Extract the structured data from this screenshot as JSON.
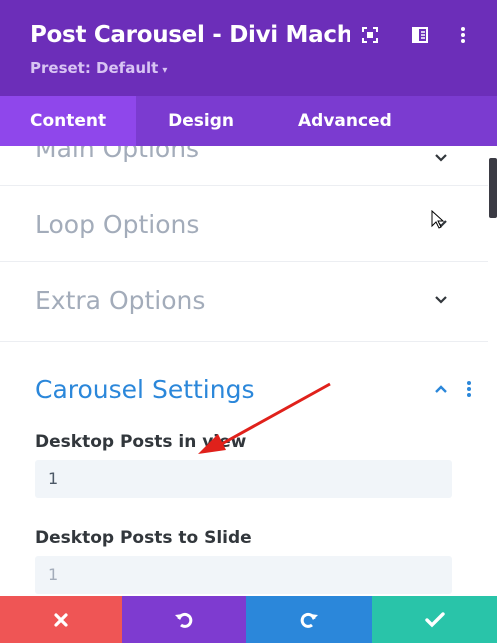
{
  "header": {
    "title": "Post Carousel - Divi Machin...",
    "preset": "Preset: Default",
    "icons": [
      "focus-icon",
      "sidebar-icon",
      "more-vertical-icon"
    ]
  },
  "tabs": [
    {
      "label": "Content",
      "active": true
    },
    {
      "label": "Design",
      "active": false
    },
    {
      "label": "Advanced",
      "active": false
    }
  ],
  "sections": [
    {
      "title": "Main Options",
      "state": "collapsed"
    },
    {
      "title": "Loop Options",
      "state": "collapsed"
    },
    {
      "title": "Extra Options",
      "state": "collapsed"
    }
  ],
  "carousel": {
    "title": "Carousel Settings",
    "state": "expanded",
    "fields": [
      {
        "label": "Desktop Posts in view",
        "value": "1"
      },
      {
        "label": "Desktop Posts to Slide",
        "value": "1"
      }
    ]
  },
  "footer": {
    "buttons": [
      {
        "name": "discard",
        "color": "#ef5555"
      },
      {
        "name": "undo",
        "color": "#7e3bd0"
      },
      {
        "name": "redo",
        "color": "#2b87da"
      },
      {
        "name": "save",
        "color": "#29c4a9"
      }
    ]
  },
  "colors": {
    "header": "#6c2eb9",
    "tabs": "#7b3bd0",
    "active_tab": "#8f47eb",
    "section_title": "#a3acba",
    "accent": "#2b87da",
    "annotation_arrow": "#e0211b"
  }
}
